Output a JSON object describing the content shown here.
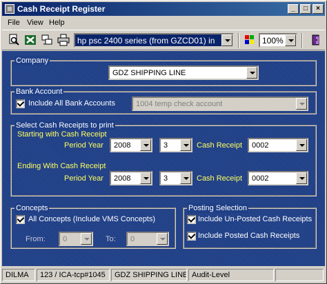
{
  "window": {
    "title": "Cash Receipt Register"
  },
  "menu": [
    "File",
    "View",
    "Help"
  ],
  "toolbar": {
    "printer": "hp psc 2400 series (from GZCD01) in",
    "zoom": "100%"
  },
  "company": {
    "label": "Company",
    "value": "GDZ SHIPPING LINE"
  },
  "bank": {
    "label": "Bank Account",
    "include_all_label": "Include All Bank Accounts",
    "include_all_checked": true,
    "account": "1004 temp check account"
  },
  "select": {
    "label": "Select Cash Receipts to print",
    "start_label": "Starting with Cash Receipt",
    "end_label": "Ending With Cash Receipt",
    "period_year_label": "Period Year",
    "cash_receipt_label": "Cash Receipt",
    "start": {
      "year": "2008",
      "period": "3",
      "receipt": "0002"
    },
    "end": {
      "year": "2008",
      "period": "3",
      "receipt": "0002"
    }
  },
  "concepts": {
    "label": "Concepts",
    "all_label": "All Concepts (Include VMS Concepts)",
    "all_checked": true,
    "from_label": "From:",
    "to_label": "To:",
    "from": "0",
    "to": "0"
  },
  "posting": {
    "label": "Posting Selection",
    "unposted_label": "Include Un-Posted Cash Receipts",
    "posted_label": "Include Posted Cash Receipts",
    "unposted_checked": true,
    "posted_checked": true
  },
  "status": [
    "DILMA",
    "123 / ICA-tcp#1045",
    "GDZ SHIPPING LINE",
    "Audit-Level",
    ""
  ]
}
